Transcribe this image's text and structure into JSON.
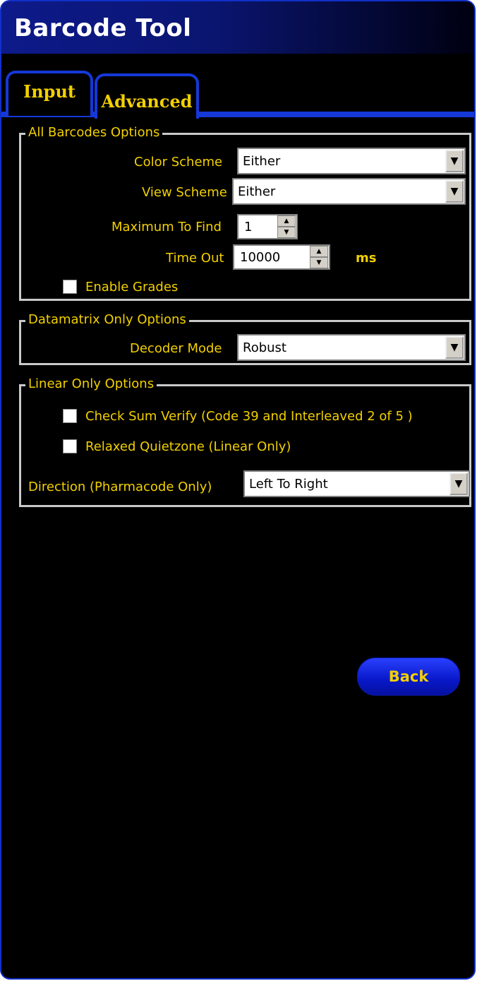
{
  "window": {
    "title": "Barcode Tool"
  },
  "tabs": [
    {
      "label": "Input",
      "active": false
    },
    {
      "label": "Advanced",
      "active": true
    }
  ],
  "all_barcodes": {
    "legend": "All Barcodes Options",
    "color_scheme": {
      "label": "Color Scheme",
      "value": "Either"
    },
    "view_scheme": {
      "label": "View Scheme",
      "value": "Either"
    },
    "maximum_to_find": {
      "label": "Maximum To Find",
      "value": "1"
    },
    "time_out": {
      "label": "Time Out",
      "value": "10000",
      "unit": "ms"
    },
    "enable_grades": {
      "label": "Enable Grades",
      "checked": false
    }
  },
  "datamatrix": {
    "legend": "Datamatrix Only Options",
    "decoder_mode": {
      "label": "Decoder Mode",
      "value": "Robust"
    }
  },
  "linear": {
    "legend": "Linear Only Options",
    "check_sum": {
      "label": "Check Sum Verify (Code 39 and Interleaved 2 of 5 )",
      "checked": false
    },
    "relaxed_quietzone": {
      "label": "Relaxed Quietzone (Linear Only)",
      "checked": false
    },
    "direction": {
      "label": "Direction (Pharmacode Only)",
      "value": "Left To Right"
    }
  },
  "back_label": "Back",
  "colors": {
    "accent_blue": "#1538d8",
    "label_yellow": "#f2d000",
    "background": "#000000"
  }
}
